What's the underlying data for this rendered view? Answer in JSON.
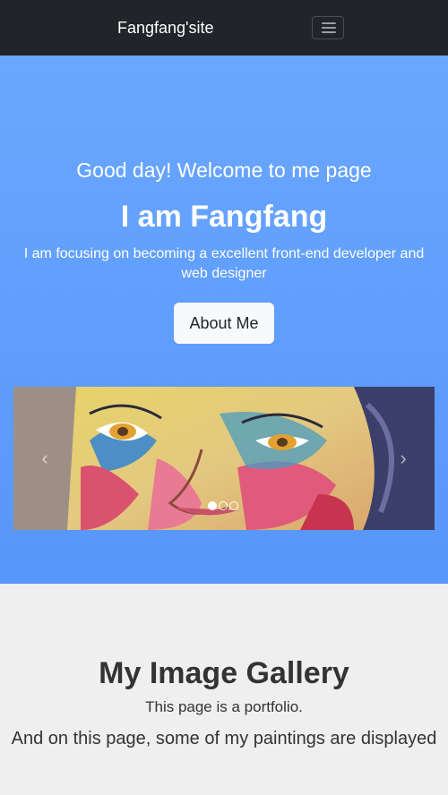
{
  "navbar": {
    "brand": "Fangfang'site",
    "toggle_icon": "hamburger-menu-icon"
  },
  "hero": {
    "greeting": "Good day! Welcome to me page",
    "heading": "I am Fangfang",
    "tagline": "I am focusing on becoming a excellent front-end developer and web designer",
    "about_button": "About Me",
    "carousel": {
      "prev_icon": "chevron-left-icon",
      "next_icon": "chevron-right-icon",
      "prev_glyph": "‹",
      "next_glyph": "›",
      "slide_count": 3,
      "active_slide": 1
    }
  },
  "gallery": {
    "title": "My Image Gallery",
    "subtitle": "This page is a portfolio.",
    "description": "And on this page, some of my paintings are displayed"
  },
  "colors": {
    "navbar_bg": "#212428",
    "hero_gradient_top": "#6aa7ff",
    "hero_gradient_bottom": "#5796fa",
    "button_bg": "#f8f9fa",
    "page_bg": "#efefef",
    "text_dark": "#333333"
  }
}
